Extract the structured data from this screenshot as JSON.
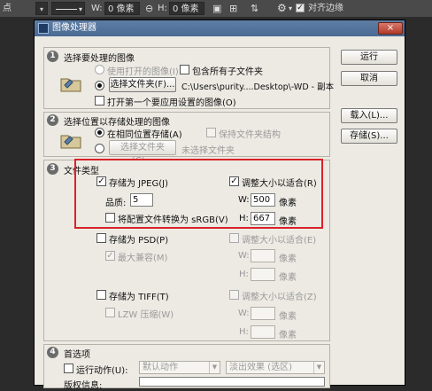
{
  "optbar": {
    "left_text": "点",
    "w_label": "W:",
    "w_value": "0 像素",
    "h_label": "H:",
    "h_value": "0 像素",
    "align_label": "对齐边缘"
  },
  "dialog": {
    "title": "图像处理器",
    "close": "×",
    "buttons": {
      "run": "运行",
      "cancel": "取消",
      "load": "载入(L)...",
      "save": "存储(S)..."
    },
    "s1": {
      "num": "1",
      "title": "选择要处理的图像",
      "use_open": "使用打开的图像(I)",
      "include_sub": "包含所有子文件夹",
      "select_folder": "选择文件夹(F)...",
      "path": "C:\\Users\\purity....Desktop\\-WD - 副本",
      "open_first": "打开第一个要应用设置的图像(O)"
    },
    "s2": {
      "num": "2",
      "title": "选择位置以存储处理的图像",
      "same_loc": "在相同位置存储(A)",
      "keep_struct": "保持文件夹结构",
      "select_folder": "选择文件夹(C)...",
      "none_selected": "未选择文件夹"
    },
    "s3": {
      "num": "3",
      "title": "文件类型",
      "jpeg": "存储为 JPEG(J)",
      "jpeg_resize": "调整大小以适合(R)",
      "quality_label": "品质:",
      "quality_value": "5",
      "srgb": "将配置文件转换为 sRGB(V)",
      "w_label": "W:",
      "w_value": "500",
      "h_label": "H:",
      "h_value": "667",
      "unit": "像素",
      "psd": "存储为 PSD(P)",
      "psd_resize": "调整大小以适合(E)",
      "max_compat": "最大兼容(M)",
      "tiff": "存储为 TIFF(T)",
      "tiff_resize": "调整大小以适合(Z)",
      "lzw": "LZW 压缩(W)"
    },
    "s4": {
      "num": "4",
      "title": "首选项",
      "run_action": "运行动作(U):",
      "default_action": "默认动作",
      "fade_effect": "淡出效果 (选区)",
      "copyright": "版权信息:"
    },
    "check": "✓"
  }
}
